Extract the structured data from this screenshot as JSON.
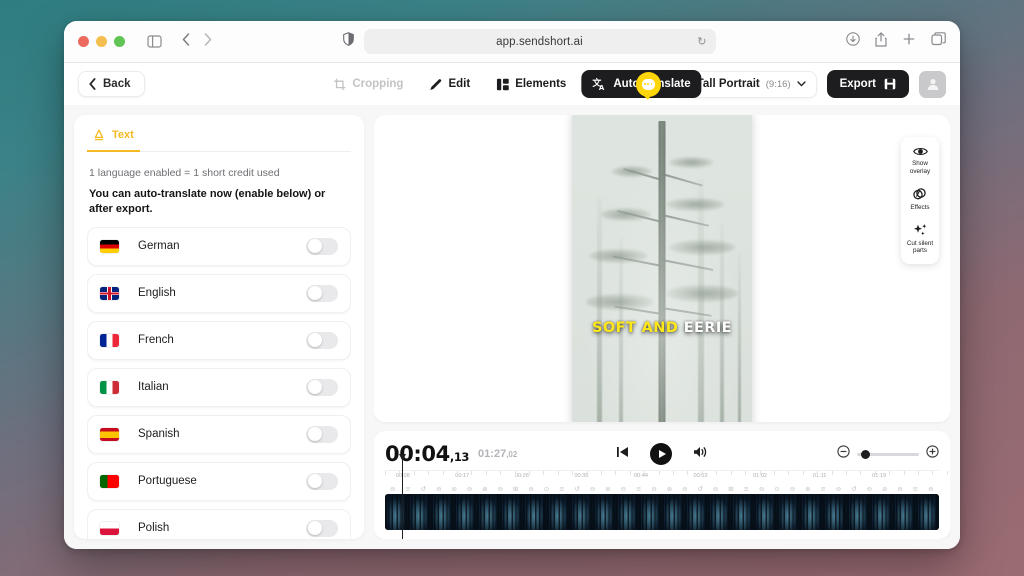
{
  "browser": {
    "url": "app.sendshort.ai",
    "icons": {
      "sidebar": "sidebar-toggle-icon",
      "back": "nav-back-icon",
      "forward": "nav-forward-icon",
      "shield": "privacy-shield-icon",
      "reload": "reload-icon",
      "downloads": "downloads-icon",
      "share": "share-icon",
      "newtab": "new-tab-icon",
      "tabs": "tab-overview-icon"
    }
  },
  "toolbar": {
    "back_label": "Back",
    "tools": [
      {
        "label": "Cropping",
        "icon": "crop-icon",
        "state": "disabled"
      },
      {
        "label": "Edit",
        "icon": "pencil-icon",
        "state": "normal"
      },
      {
        "label": "Elements",
        "icon": "elements-icon",
        "state": "normal"
      },
      {
        "label": "Auto translate",
        "icon": "translate-icon",
        "state": "active"
      }
    ],
    "ratio_label": "Tall Portrait",
    "ratio_value": "(9:16)",
    "export_label": "Export"
  },
  "sidebar": {
    "tab_label": "Text",
    "credit_line": "1 language enabled = 1 short credit used",
    "note": "You can auto-translate now (enable below) or after export.",
    "languages": [
      {
        "name": "German",
        "flag": "f-de",
        "enabled": false
      },
      {
        "name": "English",
        "flag": "f-gb",
        "enabled": false
      },
      {
        "name": "French",
        "flag": "f-fr",
        "enabled": false
      },
      {
        "name": "Italian",
        "flag": "f-it",
        "enabled": false
      },
      {
        "name": "Spanish",
        "flag": "f-es",
        "enabled": false
      },
      {
        "name": "Portuguese",
        "flag": "f-pt",
        "enabled": false
      },
      {
        "name": "Polish",
        "flag": "f-pl",
        "enabled": false
      }
    ]
  },
  "preview": {
    "caption_yellow": "SOFT AND",
    "caption_white": "EERIE",
    "side_tools": [
      {
        "label": "Show overlay",
        "icon": "eye-icon"
      },
      {
        "label": "Effects",
        "icon": "effects-rings-icon"
      },
      {
        "label": "Cut silent parts",
        "icon": "sparkles-icon"
      }
    ]
  },
  "player": {
    "current_time": "00:04",
    "current_frames": ",13",
    "total_time": "01:27",
    "total_frames": ",02",
    "controls": {
      "skip_start": "skip-to-start-icon",
      "play": "play-icon",
      "volume": "volume-icon",
      "zoom_out": "zoom-out-icon",
      "zoom_in": "zoom-in-icon"
    },
    "ruler_labels": [
      "00:08",
      "00:17",
      "00:26",
      "00:35",
      "00:44",
      "00:53",
      "01:02",
      "01:11",
      "01:19"
    ]
  },
  "colors": {
    "accent_yellow": "#f5b921",
    "dark": "#1d1d1f",
    "caption_yellow": "#ffe81a"
  }
}
